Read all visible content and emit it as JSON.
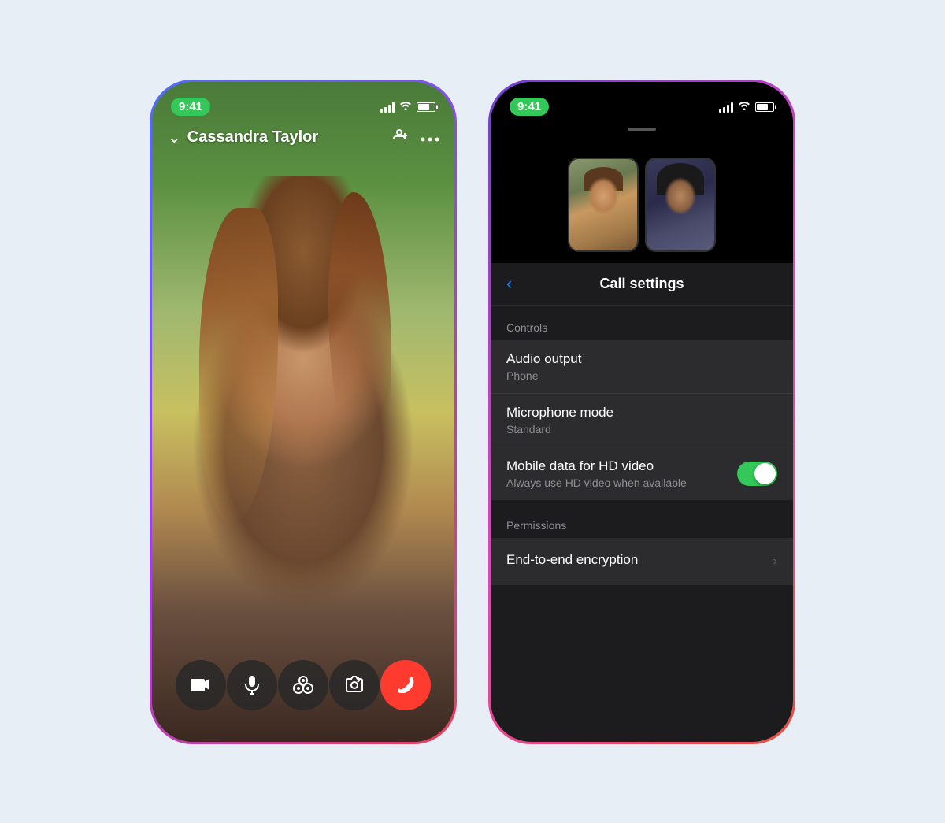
{
  "background": "#e8eef5",
  "leftPhone": {
    "statusBar": {
      "time": "9:41",
      "timeColor": "#34c759"
    },
    "callHeader": {
      "callerName": "Cassandra Taylor",
      "chevronIcon": "chevron-down",
      "addPersonIcon": "add-person",
      "moreIcon": "ellipsis"
    },
    "controls": [
      {
        "icon": "video-camera",
        "type": "dark",
        "label": "Video"
      },
      {
        "icon": "microphone",
        "type": "dark",
        "label": "Mute"
      },
      {
        "icon": "effects",
        "type": "dark",
        "label": "Effects"
      },
      {
        "icon": "flip-camera",
        "type": "dark",
        "label": "Flip"
      },
      {
        "icon": "end-call",
        "type": "red",
        "label": "End"
      }
    ]
  },
  "rightPhone": {
    "statusBar": {
      "time": "9:41"
    },
    "nav": {
      "backLabel": "‹",
      "title": "Call settings"
    },
    "sections": [
      {
        "header": "Controls",
        "rows": [
          {
            "title": "Audio output",
            "subtitle": "Phone",
            "hasChevron": false,
            "hasToggle": false
          },
          {
            "title": "Microphone mode",
            "subtitle": "Standard",
            "hasChevron": false,
            "hasToggle": false
          },
          {
            "title": "Mobile data for HD video",
            "subtitle": "Always use HD video when available",
            "hasChevron": false,
            "hasToggle": true,
            "toggleOn": true
          }
        ]
      },
      {
        "header": "Permissions",
        "rows": [
          {
            "title": "End-to-end encryption",
            "subtitle": "",
            "hasChevron": true,
            "hasToggle": false
          }
        ]
      }
    ]
  }
}
